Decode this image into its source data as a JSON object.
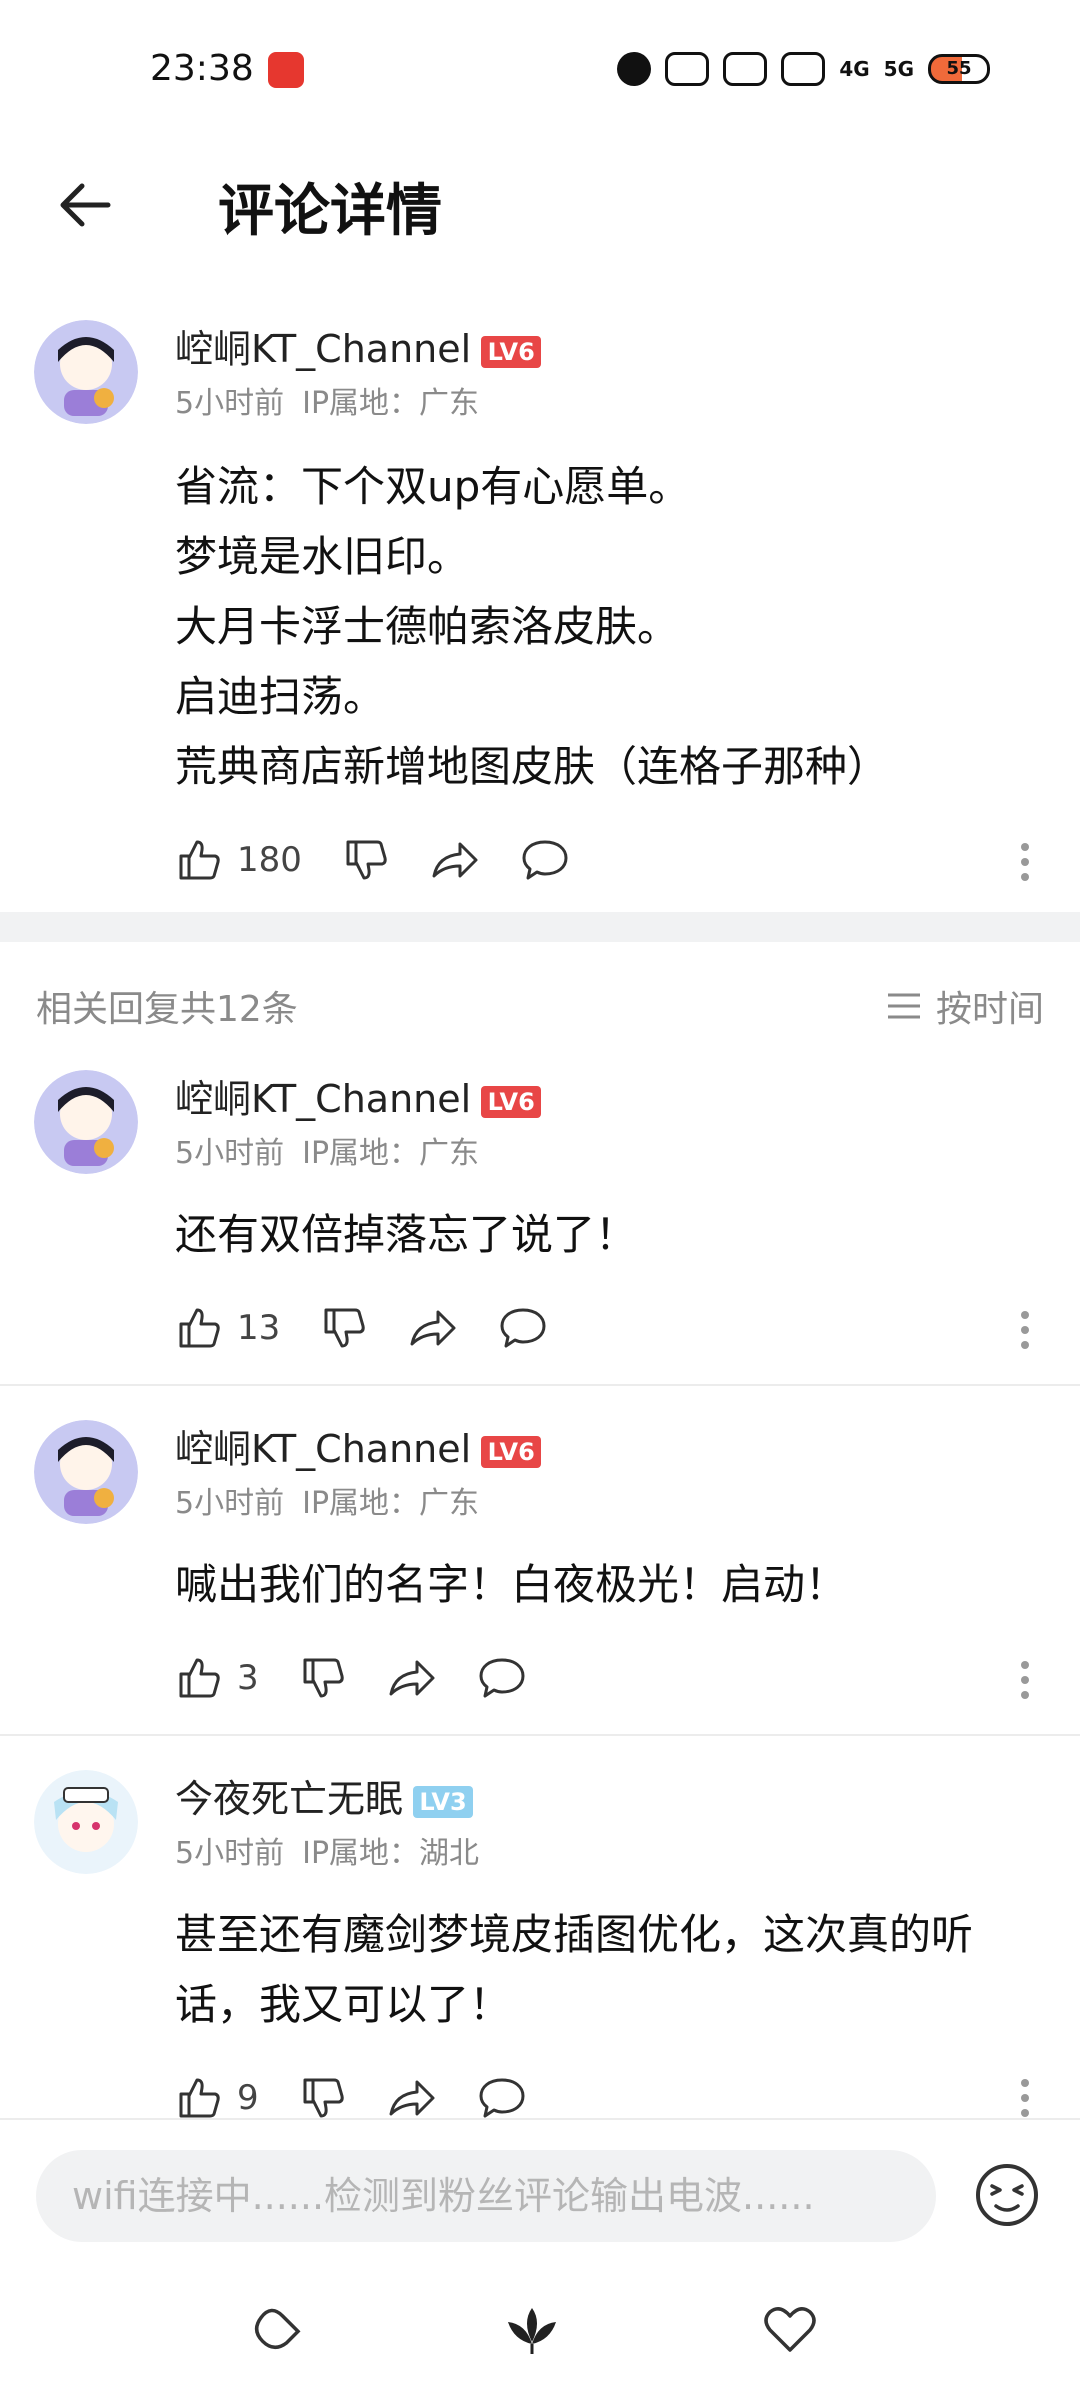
{
  "status_bar": {
    "time": "23:38",
    "network": [
      "4G",
      "5G"
    ],
    "battery": "55"
  },
  "header": {
    "title": "评论详情"
  },
  "main_comment": {
    "username": "崆峒KT_Channel",
    "level": "LV6",
    "time": "5小时前",
    "ip": "IP属地：广东",
    "lines": [
      "省流：下个双up有心愿单。",
      "梦境是水旧印。",
      "大月卡浮士德帕索洛皮肤。",
      "启迪扫荡。",
      "荒典商店新增地图皮肤（连格子那种）"
    ],
    "likes": "180"
  },
  "replies_bar": {
    "count_label": "相关回复共12条",
    "sort_label": "按时间"
  },
  "replies": [
    {
      "username": "崆峒KT_Channel",
      "level": "LV6",
      "time": "5小时前",
      "ip": "IP属地：广东",
      "text": "还有双倍掉落忘了说了！",
      "likes": "13"
    },
    {
      "username": "崆峒KT_Channel",
      "level": "LV6",
      "time": "5小时前",
      "ip": "IP属地：广东",
      "text": "喊出我们的名字！白夜极光！启动！",
      "likes": "3"
    },
    {
      "username": "今夜死亡无眠",
      "level": "LV3",
      "time": "5小时前",
      "ip": "IP属地：湖北",
      "lines": [
        "甚至还有魔剑梦境皮插图优化，这次真的听",
        "话，我又可以了！"
      ],
      "likes": "9"
    }
  ],
  "bottom_bar": {
    "input_placeholder": "wifi连接中......检测到粉丝评论输出电波......"
  },
  "colors": {
    "level_red": "#e84646",
    "level_blue": "#8fd0f0",
    "meta_gray": "#8a8a8a"
  }
}
